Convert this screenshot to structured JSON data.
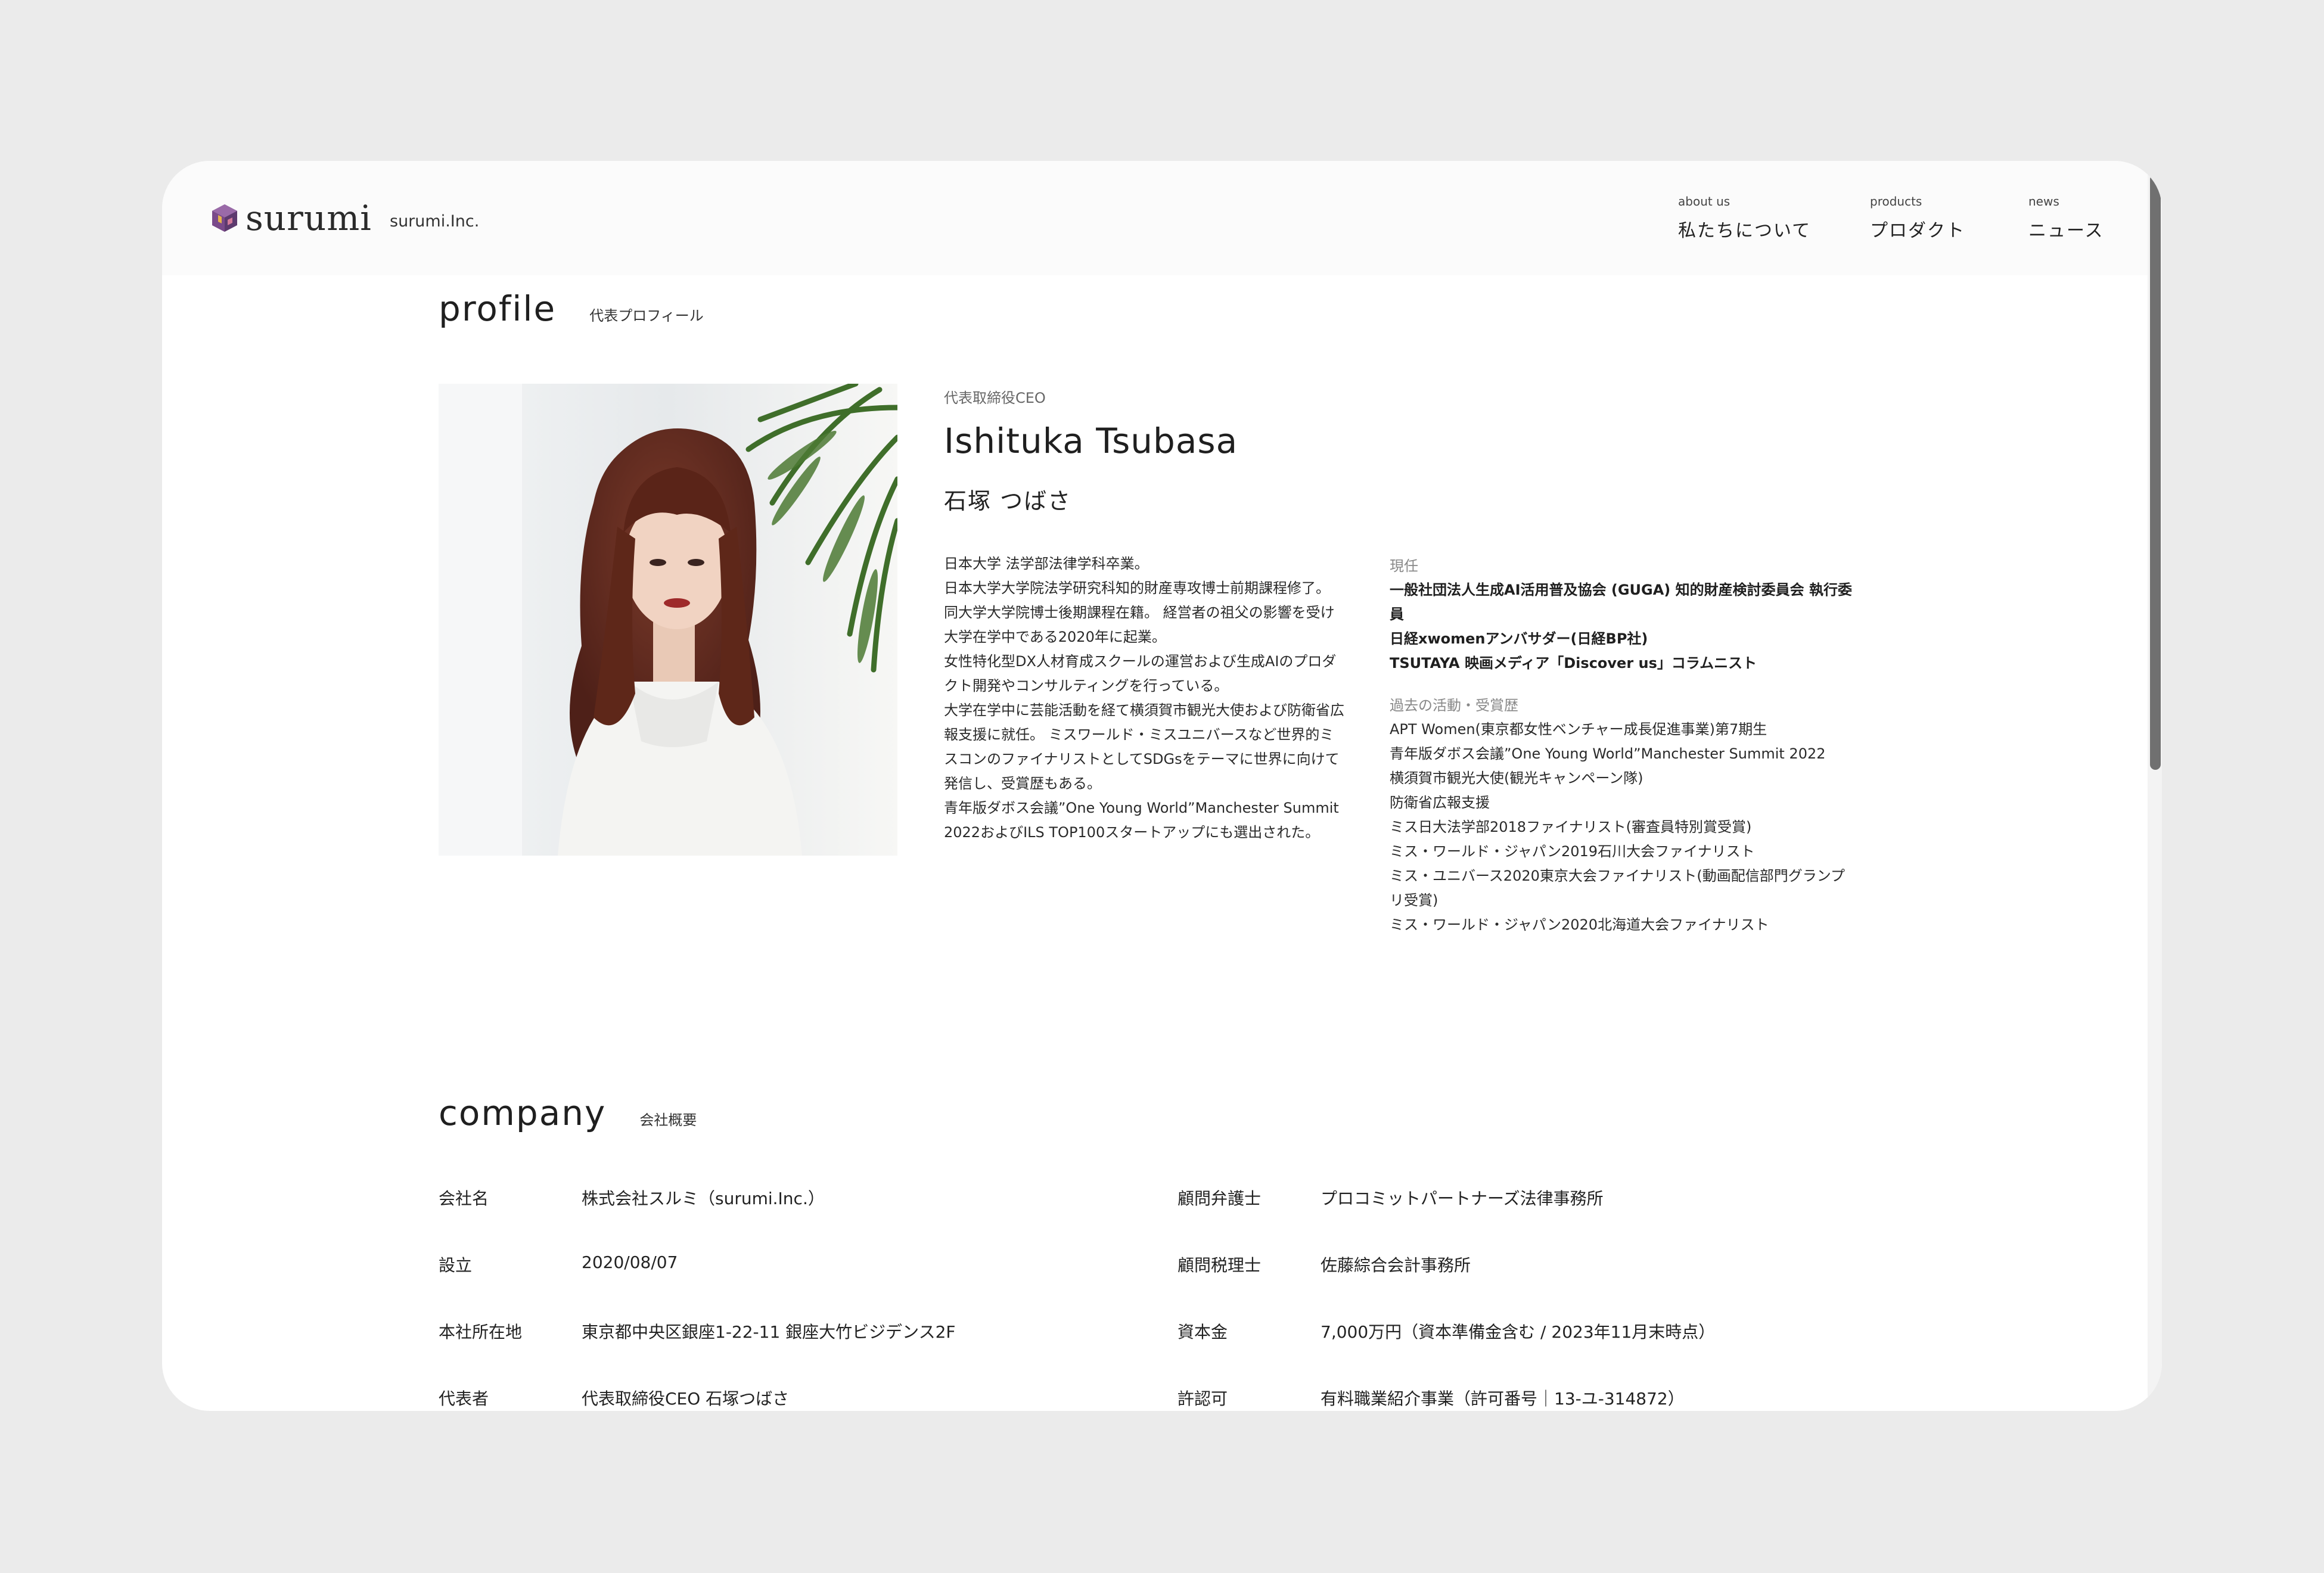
{
  "brand": {
    "name": "surumi",
    "company": "surumi.Inc."
  },
  "nav": [
    {
      "en": "about us",
      "jp": "私たちについて"
    },
    {
      "en": "products",
      "jp": "プロダクト"
    },
    {
      "en": "news",
      "jp": "ニュース"
    }
  ],
  "profile": {
    "title_en": "profile",
    "title_jp": "代表プロフィール",
    "role": "代表取締役CEO",
    "name_en": "Ishituka Tsubasa",
    "name_jp": "石塚 つばさ",
    "bio": [
      "日本大学 法学部法律学科卒業。",
      "日本大学大学院法学研究科知的財産専攻博士前期課程修了。",
      "同大学大学院博士後期課程在籍。 経営者の祖父の影響を受け",
      "大学在学中である2020年に起業。",
      "女性特化型DX人材育成スクールの運営および生成AIのプロダ",
      "クト開発やコンサルティングを行っている。",
      "大学在学中に芸能活動を経て横須賀市観光大使および防衛省広",
      "報支援に就任。 ミスワールド・ミスユニバースなど世界的ミ",
      "スコンのファイナリストとしてSDGsをテーマに世界に向けて",
      "発信し、受賞歴もある。",
      "青年版ダボス会議”One Young World”Manchester Summit",
      "2022およびILS TOP100スタートアップにも選出された。"
    ],
    "current_head": "現任",
    "current": [
      "一般社団法人生成AI活用普及協会 (GUGA) 知的財産検討委員会 執行委",
      "員",
      "日経xwomenアンバサダー(日経BP社)",
      "TSUTAYA 映画メディア「Discover us」コラムニスト"
    ],
    "past_head": "過去の活動・受賞歴",
    "past": [
      "APT Women(東京都女性ベンチャー成長促進事業)第7期生",
      "青年版ダボス会議”One Young World”Manchester Summit 2022",
      "横須賀市観光大使(観光キャンペーン隊)",
      "防衛省広報支援",
      "ミス日大法学部2018ファイナリスト(審査員特別賞受賞)",
      "ミス・ワールド・ジャパン2019石川大会ファイナリスト",
      "ミス・ユニバース2020東京大会ファイナリスト(動画配信部門グランプ",
      "リ受賞)",
      "ミス・ワールド・ジャパン2020北海道大会ファイナリスト"
    ]
  },
  "company": {
    "title_en": "company",
    "title_jp": "会社概要",
    "rows_left": [
      {
        "label": "会社名",
        "value": "株式会社スルミ（surumi.Inc.）"
      },
      {
        "label": "設立",
        "value": "2020/08/07"
      },
      {
        "label": "本社所在地",
        "value": "東京都中央区銀座1-22-11 銀座大竹ビジデンス2F"
      },
      {
        "label": "代表者",
        "value": "代表取締役CEO 石塚つばさ"
      }
    ],
    "rows_right": [
      {
        "label": "顧問弁護士",
        "value": "プロコミットパートナーズ法律事務所"
      },
      {
        "label": "顧問税理士",
        "value": "佐藤綜合会計事務所"
      },
      {
        "label": "資本金",
        "value": "7,000万円（資本準備金含む / 2023年11月末時点）"
      },
      {
        "label": "許認可",
        "value": "有料職業紹介事業（許可番号｜13-ユ-314872）"
      }
    ]
  },
  "colors": {
    "page_bg": "#ebebeb",
    "card_bg": "#ffffff",
    "header_bg": "#fbfbfb",
    "logo_accent": "#6b3d78"
  }
}
